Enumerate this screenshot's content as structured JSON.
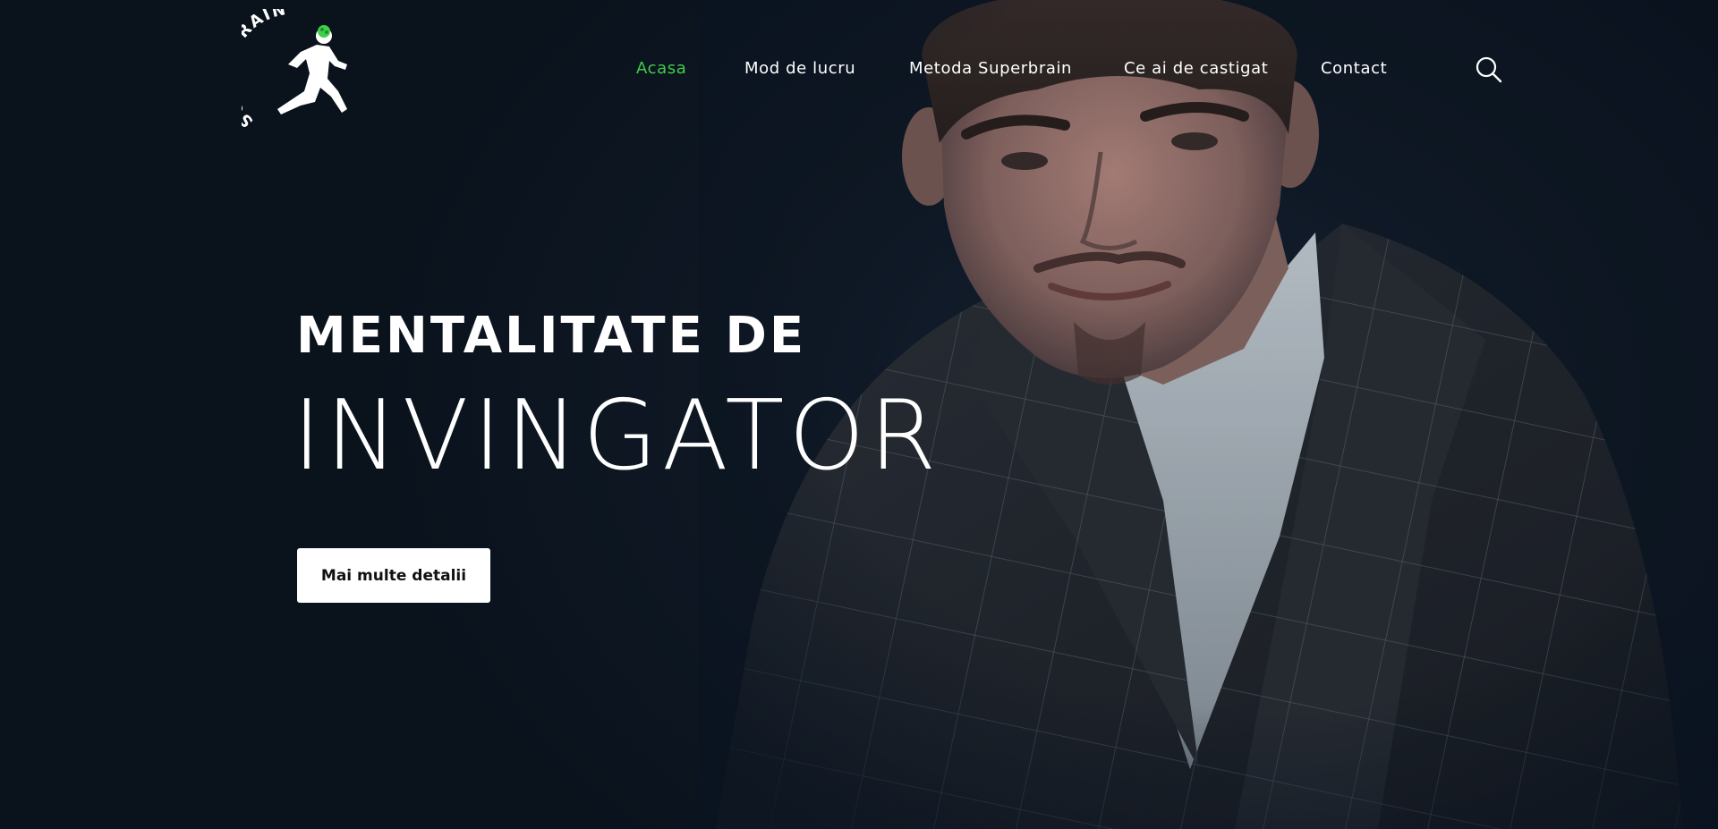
{
  "brand": {
    "logo_text": "SUPER BRAIN",
    "accent_color": "#3ecf4a"
  },
  "nav": {
    "items": [
      {
        "label": "Acasa",
        "active": true
      },
      {
        "label": "Mod de lucru",
        "active": false
      },
      {
        "label": "Metoda Superbrain",
        "active": false
      },
      {
        "label": "Ce ai de castigat",
        "active": false
      },
      {
        "label": "Contact",
        "active": false
      }
    ],
    "search_icon": "search-icon"
  },
  "hero": {
    "headline_line1": "MENTALITATE DE",
    "headline_line2": "INVINGATOR",
    "cta_label": "Mai multe detalii",
    "background_color": "#0b1420"
  }
}
